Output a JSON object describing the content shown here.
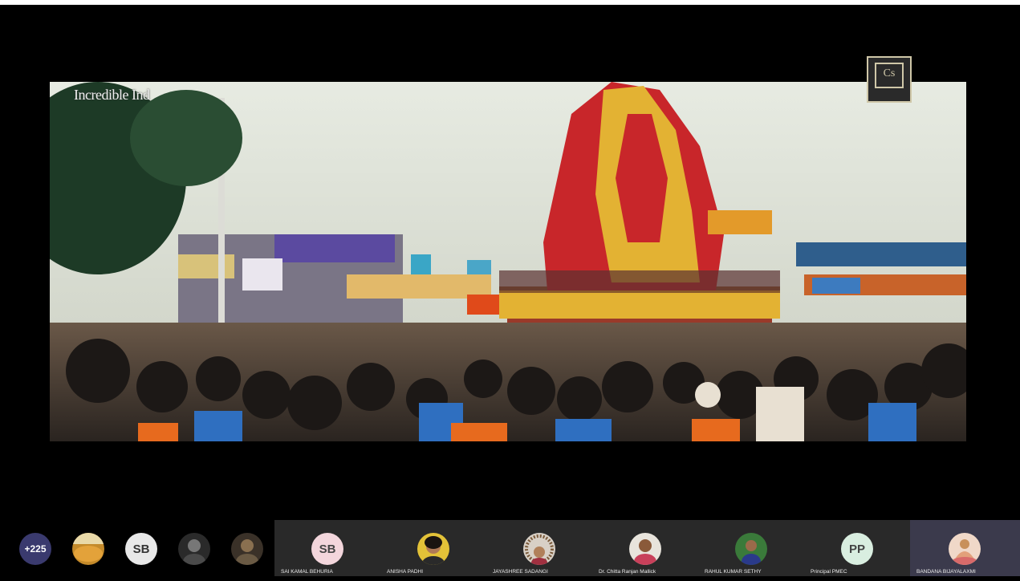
{
  "video": {
    "watermark_text": "Incredible Ind",
    "logo_mark": "Cs"
  },
  "participants": {
    "overflow_count": "+225",
    "small_avatars": [
      {
        "type": "photo",
        "icon": "photo-avatar-1"
      },
      {
        "type": "initials",
        "initials": "SB"
      },
      {
        "type": "photo",
        "icon": "photo-avatar-2"
      },
      {
        "type": "photo",
        "icon": "photo-avatar-3"
      }
    ],
    "tiles": [
      {
        "name": "SAI KAMAL BEHURIA",
        "initials": "SB",
        "avatar_color": "#f3d6dc"
      },
      {
        "name": "ANISHA PADHI",
        "icon": "photo-avatar-anisha"
      },
      {
        "name": "JAYASHREE SADANGI",
        "icon": "photo-avatar-jayashree"
      },
      {
        "name": "Dr. Chitta Ranjan Mallick",
        "icon": "photo-avatar-chitta"
      },
      {
        "name": "RAHUL KUMAR SETHY",
        "icon": "photo-avatar-rahul"
      },
      {
        "name": "Principal PMEC",
        "initials": "PP",
        "avatar_color": "#d9eee0"
      },
      {
        "name": "BANDANA BIJAYALAXMI",
        "icon": "photo-avatar-bandana"
      }
    ]
  },
  "colors": {
    "background": "#000000",
    "tile_bg": "#292929",
    "active_tile_bg": "#3b3a4c",
    "overflow_badge": "#3a3a6e"
  }
}
